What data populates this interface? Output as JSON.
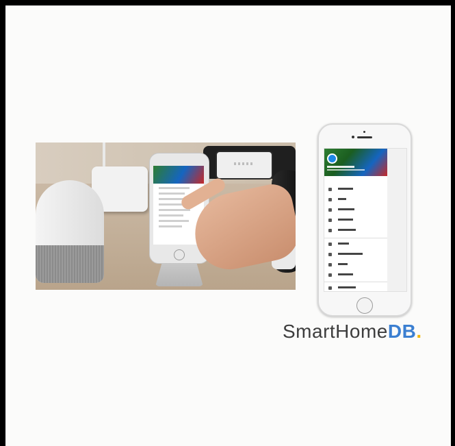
{
  "logo": {
    "brand_text": "SmartHome",
    "db_text": "DB",
    "dot_text": "."
  },
  "colors": {
    "brand_gray": "#3d3d3d",
    "brand_blue": "#3b7fd1",
    "brand_yellow": "#f2b705"
  },
  "phone_menu": {
    "items": [
      {
        "icon": "chat-icon"
      },
      {
        "icon": "music-icon"
      },
      {
        "icon": "home-control-icon"
      },
      {
        "icon": "list-icon"
      },
      {
        "icon": "more-icon"
      },
      {
        "icon": "devices-icon"
      },
      {
        "icon": "account-icon"
      },
      {
        "icon": "offers-icon"
      },
      {
        "icon": "plus-icon"
      },
      {
        "icon": "store-icon"
      }
    ]
  }
}
